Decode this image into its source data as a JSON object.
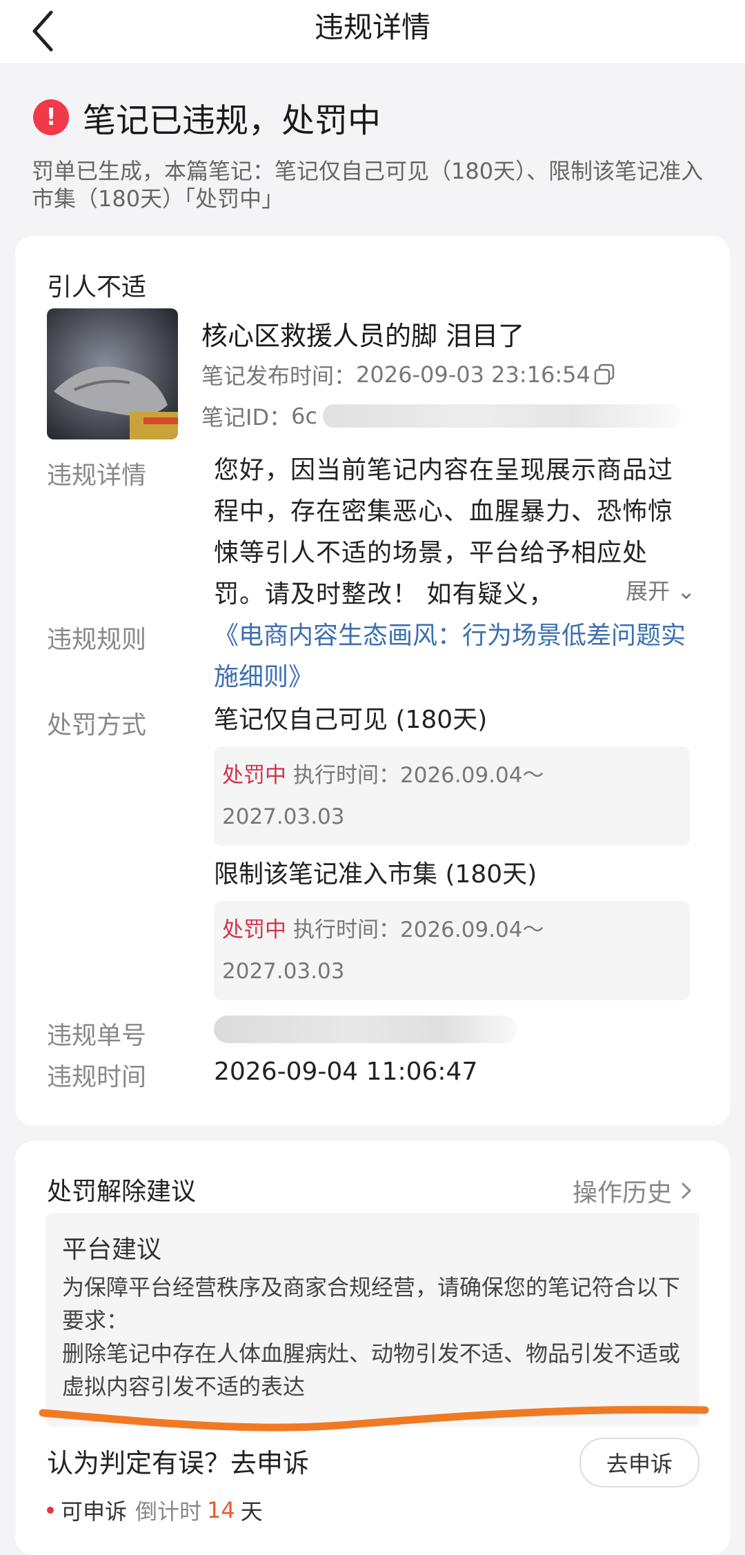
{
  "header": {
    "title": "违规详情"
  },
  "alert": {
    "title": "笔记已违规，处罚中",
    "description": "罚单已生成，本篇笔记：笔记仅自己可见（180天）、限制该笔记准入市集（180天）「处罚中」"
  },
  "note": {
    "category": "引人不适",
    "title": "核心区救援人员的脚 泪目了",
    "publish_label": "笔记发布时间：",
    "publish_time": "2026-09-03 23:16:54",
    "id_label": "笔记ID：",
    "id_prefix": "6c"
  },
  "violation": {
    "detail_label": "违规详情",
    "detail_text": "您好，因当前笔记内容在呈现展示商品过程中，存在密集恶心、血腥暴力、恐怖惊悚等引人不适的场景，平台给予相应处罚。请及时整改！ 如有疑义，",
    "expand_label": "展开",
    "rule_label": "违规规则",
    "rule_text": "《电商内容生态画风：行为场景低差问题实施细则》",
    "penalty_label": "处罚方式",
    "penalties": [
      {
        "title": "笔记仅自己可见 (180天)",
        "status": "处罚中",
        "exec_label": "执行时间：",
        "start": "2026.09.04～",
        "end": "2027.03.03"
      },
      {
        "title": "限制该笔记准入市集 (180天)",
        "status": "处罚中",
        "exec_label": "执行时间：",
        "start": "2026.09.04～",
        "end": "2027.03.03"
      }
    ],
    "order_label": "违规单号",
    "time_label": "违规时间",
    "time_value": "2026-09-04 11:06:47"
  },
  "suggestion": {
    "title": "处罚解除建议",
    "history_label": "操作历史",
    "platform_title": "平台建议",
    "text1": "为保障平台经营秩序及商家合规经营，请确保您的笔记符合以下要求：",
    "text2": "删除笔记中存在人体血腥病灶、动物引发不适、物品引发不适或虚拟内容引发不适的表达"
  },
  "appeal": {
    "question": "认为判定有误？去申诉",
    "button": "去申诉",
    "status": "可申诉",
    "countdown_label": "倒计时",
    "days": "14",
    "unit": "天"
  },
  "colors": {
    "alert_red": "#f03a4a",
    "link_blue": "#3b6fb0",
    "status_red": "#d2334b",
    "highlight_orange": "#f07a24"
  }
}
